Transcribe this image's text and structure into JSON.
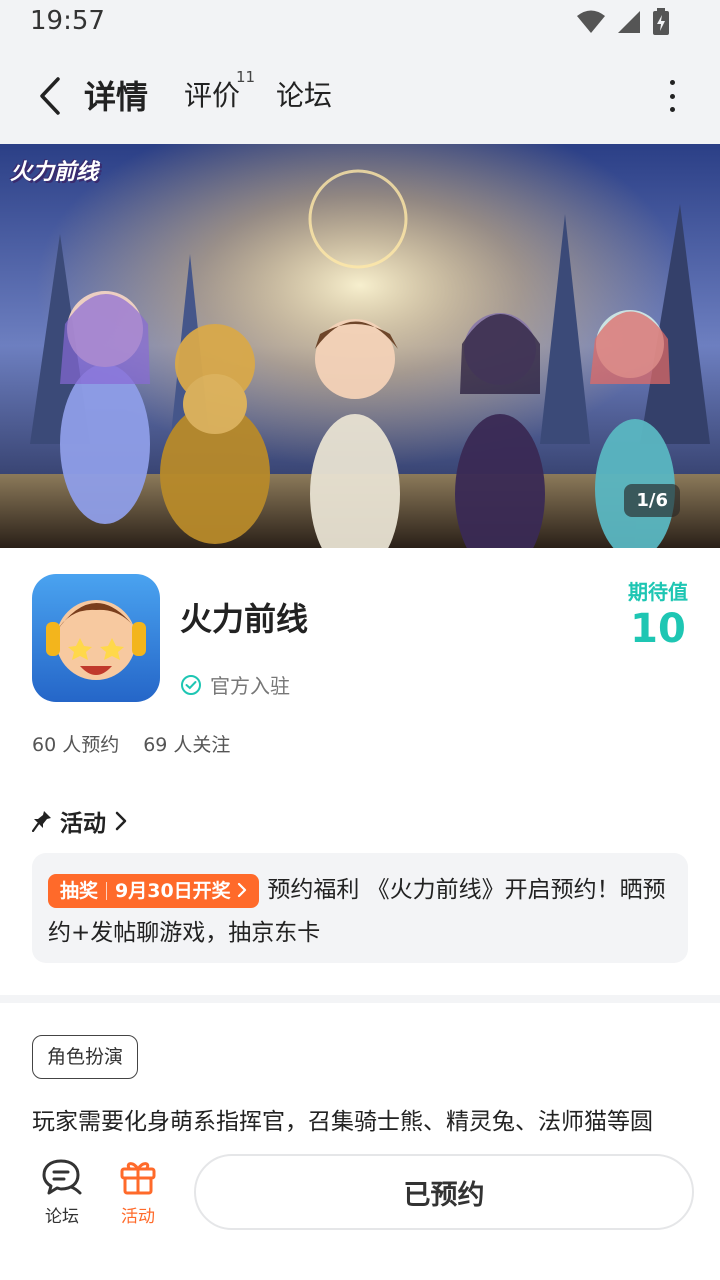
{
  "status_bar": {
    "time": "19:57"
  },
  "nav": {
    "tabs": [
      {
        "label": "详情",
        "active": true
      },
      {
        "label": "评价",
        "badge": "11"
      },
      {
        "label": "论坛"
      }
    ]
  },
  "banner": {
    "logo_text": "火力前线",
    "page_indicator": "1/6"
  },
  "game": {
    "title": "火力前线",
    "official_label": "官方入驻",
    "anticipation_label": "期待值",
    "anticipation_value": "10",
    "reservations": "60 人预约",
    "followers": "69 人关注"
  },
  "activity": {
    "section_title": "活动",
    "tag_type": "抽奖",
    "tag_date": "9月30日开奖",
    "text": "预约福利 《火力前线》开启预约！晒预约+发帖聊游戏，抽京东卡"
  },
  "details": {
    "genre": "角色扮演",
    "description": "玩家需要化身萌系指挥官，召集骑士熊、精灵兔、法师猫等圆"
  },
  "bottom": {
    "forum_label": "论坛",
    "activity_label": "活动",
    "reserve_button": "已预约"
  },
  "colors": {
    "accent": "#1ec6b3",
    "orange": "#ff6a2a"
  }
}
